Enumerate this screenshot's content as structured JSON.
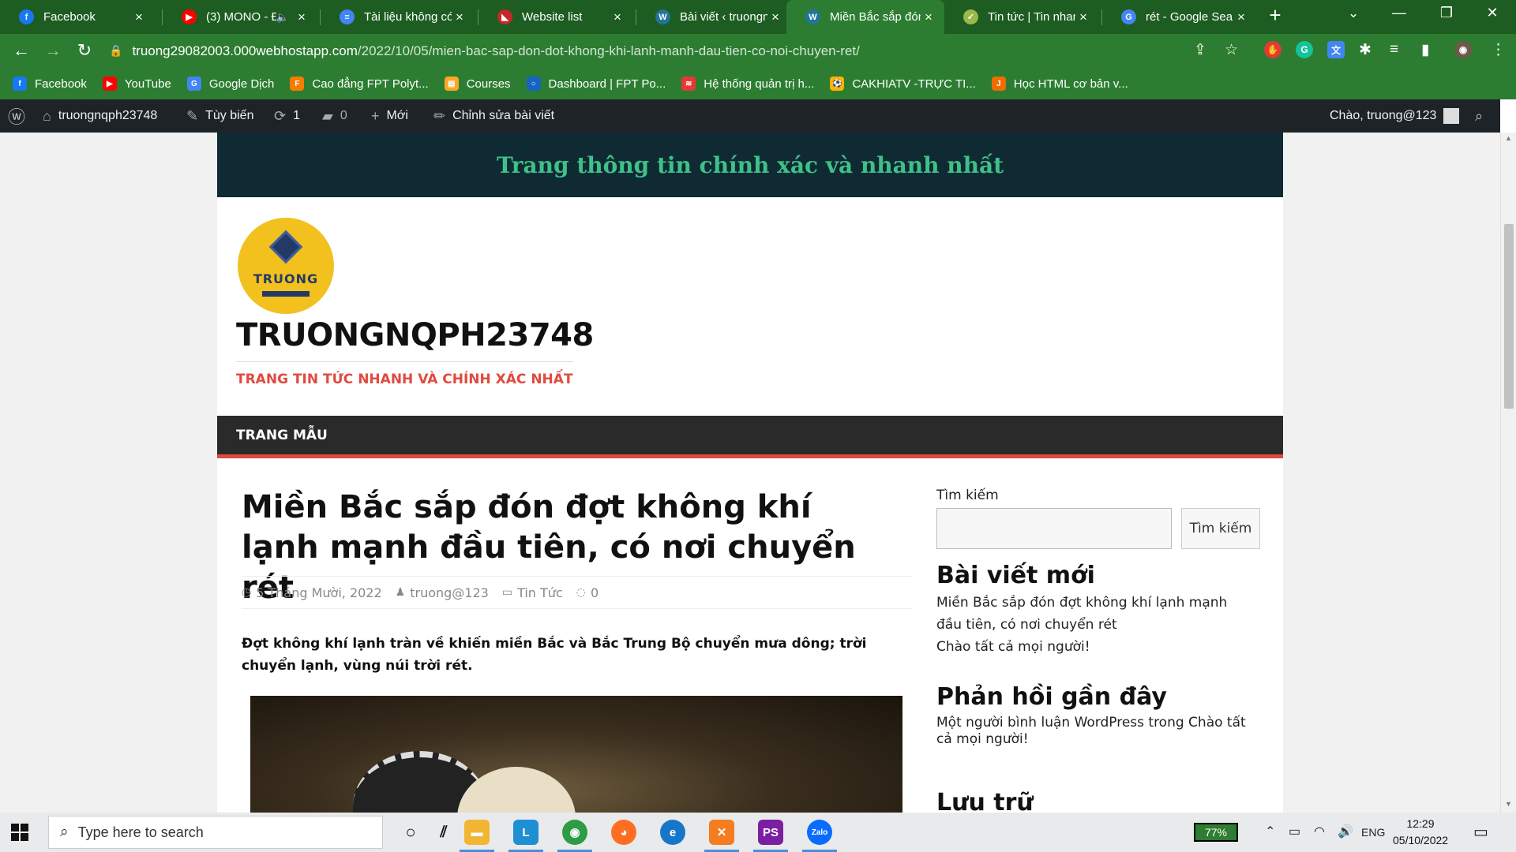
{
  "browser": {
    "tabs": [
      {
        "title": "Facebook",
        "icon": "facebook-icon",
        "color": "#1877f2",
        "glyph": "f"
      },
      {
        "title": "(3) MONO - Đ",
        "icon": "youtube-icon",
        "color": "#ff0000",
        "glyph": "▶",
        "muted": true
      },
      {
        "title": "Tài liệu không có",
        "icon": "docs-icon",
        "color": "#4285f4",
        "glyph": "≡"
      },
      {
        "title": "Website list",
        "icon": "webhost-icon",
        "color": "#c62828",
        "glyph": "◣"
      },
      {
        "title": "Bài viết ‹ truongn",
        "icon": "wordpress-icon",
        "color": "#21759b",
        "glyph": "W"
      },
      {
        "title": "Miền Bắc sắp đón",
        "icon": "wordpress-icon",
        "color": "#21759b",
        "glyph": "W",
        "active": true
      },
      {
        "title": "Tin tức | Tin nhan",
        "icon": "site-icon",
        "color": "#9bb84a",
        "glyph": "✓"
      },
      {
        "title": "rét - Google Search",
        "icon": "google-icon",
        "color": "#4285f4",
        "glyph": "G"
      }
    ],
    "url_host": "truong29082003.000webhostapp.com",
    "url_path": "/2022/10/05/mien-bac-sap-don-dot-khong-khi-lanh-manh-dau-tien-co-noi-chuyen-ret/",
    "bookmarks": [
      {
        "label": "Facebook",
        "color": "#1877f2",
        "glyph": "f"
      },
      {
        "label": "YouTube",
        "color": "#ff0000",
        "glyph": "▶"
      },
      {
        "label": "Google Dịch",
        "color": "#4285f4",
        "glyph": "G"
      },
      {
        "label": "Cao đẳng FPT Polyt...",
        "color": "#f57c00",
        "glyph": "F"
      },
      {
        "label": "Courses",
        "color": "#f9a825",
        "glyph": "▤"
      },
      {
        "label": "Dashboard | FPT Po...",
        "color": "#1565c0",
        "glyph": "○"
      },
      {
        "label": "Hệ thống quản trị h...",
        "color": "#e53935",
        "glyph": "≋"
      },
      {
        "label": "CAKHIATV -TRỰC TI...",
        "color": "#ffb300",
        "glyph": "⚽"
      },
      {
        "label": "Học HTML cơ bản v...",
        "color": "#ef6c00",
        "glyph": "J"
      }
    ]
  },
  "adminbar": {
    "site_name": "truongnqph23748",
    "customize": "Tùy biến",
    "updates_count": "1",
    "comments_count": "0",
    "new_label": "Mới",
    "edit_label": "Chỉnh sửa bài viết",
    "greeting": "Chào, truong@123"
  },
  "site": {
    "banner_text": "Trang thông tin chính xác và nhanh nhất",
    "logo_text": "TRUONG",
    "title": "TRUONGNQPH23748",
    "tagline": "TRANG TIN TỨC NHANH VÀ CHÍNH XÁC NHẤT",
    "nav_item": "TRANG MẪU"
  },
  "post": {
    "title": "Miền Bắc sắp đón đợt không khí lạnh mạnh đầu tiên, có nơi chuyển rét",
    "date": "5 Tháng Mười, 2022",
    "author": "truong@123",
    "category": "Tin Tức",
    "comments": "0",
    "excerpt": "Đợt không khí lạnh tràn về khiến miền Bắc và Bắc Trung Bộ chuyển mưa dông; trời chuyển lạnh, vùng núi trời rét."
  },
  "sidebar": {
    "search_label": "Tìm kiếm",
    "search_button": "Tìm kiếm",
    "recent_title": "Bài viết mới",
    "recent_posts": [
      "Miền Bắc sắp đón đợt không khí lạnh mạnh đầu tiên, có nơi chuyển rét",
      "Chào tất cả mọi người!"
    ],
    "comments_title": "Phản hồi gần đây",
    "comment_text": "Một người bình luận WordPress trong Chào tất cả mọi người!",
    "archive_title": "Lưu trữ"
  },
  "taskbar": {
    "search_placeholder": "Type here to search",
    "battery": "77%",
    "lang": "ENG",
    "time": "12:29",
    "date": "05/10/2022"
  }
}
